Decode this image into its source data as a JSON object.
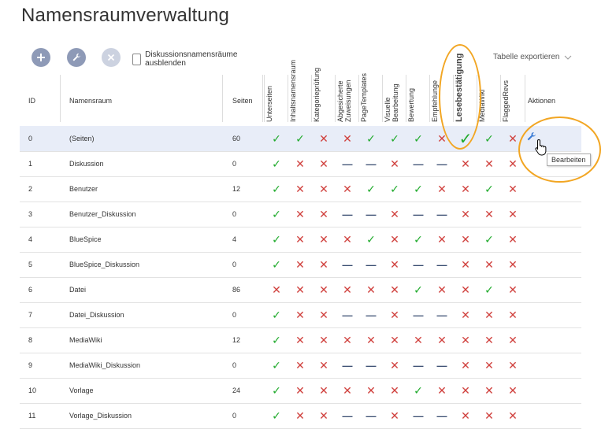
{
  "page": {
    "title": "Namensraumverwaltung"
  },
  "toolbar": {
    "add_icon": "plus-icon",
    "edit_icon": "wrench-icon",
    "delete_icon": "close-icon",
    "hide_discussion_label": "Diskussionsnamensräume ausblenden",
    "export_label": "Tabelle exportieren"
  },
  "table": {
    "headers": {
      "id": "ID",
      "name": "Namensraum",
      "pages": "Seiten",
      "actions": "Aktionen"
    },
    "flag_headers": [
      "Unterseiten",
      "Inhaltsnamensraum",
      "Kategorieprüfung",
      "Abgesicherte Zuweisungen",
      "PageTemplates",
      "Visuelle Bearbeitung",
      "Bewertung",
      "Empfehlunge",
      "Lesebestätigung",
      "MediaWiki",
      "FlaggedRevs"
    ],
    "rows": [
      {
        "id": "0",
        "name": "(Seiten)",
        "pages": "60",
        "flags": [
          "y",
          "y",
          "n",
          "n",
          "y",
          "y",
          "y",
          "n",
          "y",
          "y",
          "n"
        ],
        "selected": true
      },
      {
        "id": "1",
        "name": "Diskussion",
        "pages": "0",
        "flags": [
          "y",
          "n",
          "n",
          "-",
          "-",
          "n",
          "-",
          "-",
          "n",
          "n",
          "n"
        ]
      },
      {
        "id": "2",
        "name": "Benutzer",
        "pages": "12",
        "flags": [
          "y",
          "n",
          "n",
          "n",
          "y",
          "y",
          "y",
          "n",
          "n",
          "y",
          "n"
        ]
      },
      {
        "id": "3",
        "name": "Benutzer_Diskussion",
        "pages": "0",
        "flags": [
          "y",
          "n",
          "n",
          "-",
          "-",
          "n",
          "-",
          "-",
          "n",
          "n",
          "n"
        ]
      },
      {
        "id": "4",
        "name": "BlueSpice",
        "pages": "4",
        "flags": [
          "y",
          "n",
          "n",
          "n",
          "y",
          "n",
          "y",
          "n",
          "n",
          "y",
          "n"
        ]
      },
      {
        "id": "5",
        "name": "BlueSpice_Diskussion",
        "pages": "0",
        "flags": [
          "y",
          "n",
          "n",
          "-",
          "-",
          "n",
          "-",
          "-",
          "n",
          "n",
          "n"
        ]
      },
      {
        "id": "6",
        "name": "Datei",
        "pages": "86",
        "flags": [
          "n",
          "n",
          "n",
          "n",
          "n",
          "n",
          "y",
          "n",
          "n",
          "y",
          "n"
        ]
      },
      {
        "id": "7",
        "name": "Datei_Diskussion",
        "pages": "0",
        "flags": [
          "y",
          "n",
          "n",
          "-",
          "-",
          "n",
          "-",
          "-",
          "n",
          "n",
          "n"
        ]
      },
      {
        "id": "8",
        "name": "MediaWiki",
        "pages": "12",
        "flags": [
          "y",
          "n",
          "n",
          "n",
          "n",
          "n",
          "n",
          "n",
          "n",
          "n",
          "n"
        ]
      },
      {
        "id": "9",
        "name": "MediaWiki_Diskussion",
        "pages": "0",
        "flags": [
          "y",
          "n",
          "n",
          "-",
          "-",
          "n",
          "-",
          "-",
          "n",
          "n",
          "n"
        ]
      },
      {
        "id": "10",
        "name": "Vorlage",
        "pages": "24",
        "flags": [
          "y",
          "n",
          "n",
          "n",
          "n",
          "n",
          "y",
          "n",
          "n",
          "n",
          "n"
        ]
      },
      {
        "id": "11",
        "name": "Vorlage_Diskussion",
        "pages": "0",
        "flags": [
          "y",
          "n",
          "n",
          "-",
          "-",
          "n",
          "-",
          "-",
          "n",
          "n",
          "n"
        ]
      }
    ],
    "row_action_icon": "wrench-icon",
    "tooltip": "Bearbeiten"
  },
  "colors": {
    "yes": "#1faa2b",
    "no": "#d0403d",
    "not_applicable": "#3b4e72",
    "selected_row": "#e8edf8",
    "highlight": "#f2a623",
    "button": "#8e9ab7"
  }
}
